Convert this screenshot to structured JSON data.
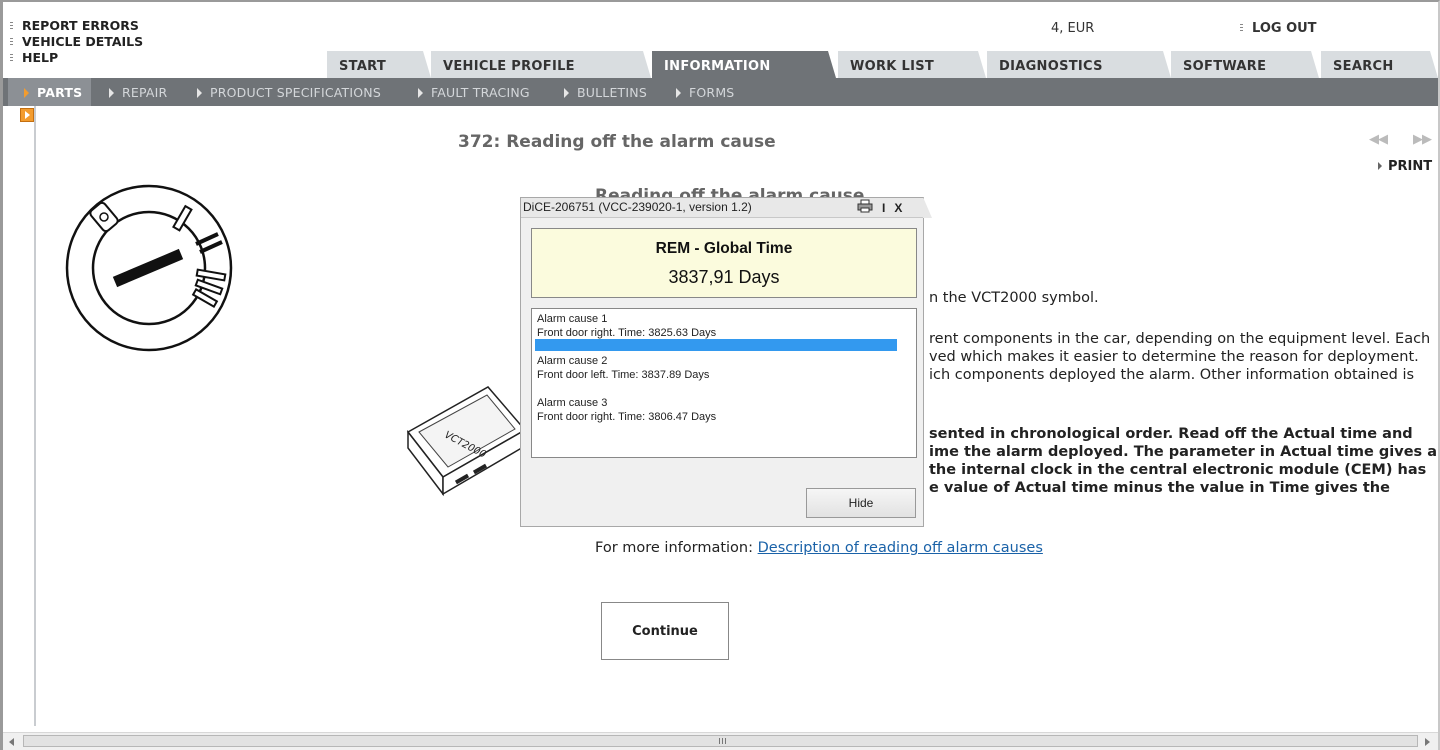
{
  "header": {
    "links": [
      "REPORT ERRORS",
      "VEHICLE DETAILS",
      "HELP"
    ],
    "currency": "4, EUR",
    "logout": "LOG OUT"
  },
  "tabs": [
    {
      "label": "START"
    },
    {
      "label": "VEHICLE PROFILE"
    },
    {
      "label": "INFORMATION",
      "active": true
    },
    {
      "label": "WORK LIST"
    },
    {
      "label": "DIAGNOSTICS"
    },
    {
      "label": "SOFTWARE"
    },
    {
      "label": "SEARCH"
    }
  ],
  "subnav": [
    {
      "label": "PARTS",
      "active": true
    },
    {
      "label": "REPAIR"
    },
    {
      "label": "PRODUCT SPECIFICATIONS"
    },
    {
      "label": "FAULT TRACING"
    },
    {
      "label": "BULLETINS"
    },
    {
      "label": "FORMS"
    }
  ],
  "content": {
    "title": "372: Reading off the alarm cause",
    "subheading": "Reading off the alarm cause",
    "print": "PRINT",
    "nav_prev": "◀◀",
    "nav_next": "▶▶",
    "vct_label": "VCT2000",
    "text1": "n the VCT2000 symbol.",
    "text2_l1": "rent components in the car, depending on the equipment level. Each",
    "text2_l2": "ved which makes it easier to determine the reason for deployment.",
    "text2_l3": "ich components deployed the alarm. Other information obtained is",
    "bold_l1": "sented in chronological order. Read off the Actual time and",
    "bold_l2": "ime the alarm deployed. The parameter in Actual time gives a",
    "bold_l3": "the internal clock in the central electronic module (CEM) has",
    "bold_l4": "e value of Actual time minus the value in Time gives the",
    "more_info_prefix": "For more information:",
    "more_info_link": "Description of reading off alarm causes",
    "continue": "Continue"
  },
  "dialog": {
    "title": "DiCE-206751   (VCC-239020-1, version 1.2)",
    "print_icon": "print-icon",
    "info": "I",
    "close": "X",
    "heading": "REM - Global Time",
    "value": "3837,91 Days",
    "items": [
      {
        "name": "Alarm cause 1",
        "detail": "Front door right. Time: 3825.63 Days"
      },
      {
        "name": "Alarm cause 2",
        "detail": "Front door left. Time: 3837.89 Days"
      },
      {
        "name": "Alarm cause 3",
        "detail": "Front door right. Time: 3806.47 Days"
      }
    ],
    "hide": "Hide"
  }
}
